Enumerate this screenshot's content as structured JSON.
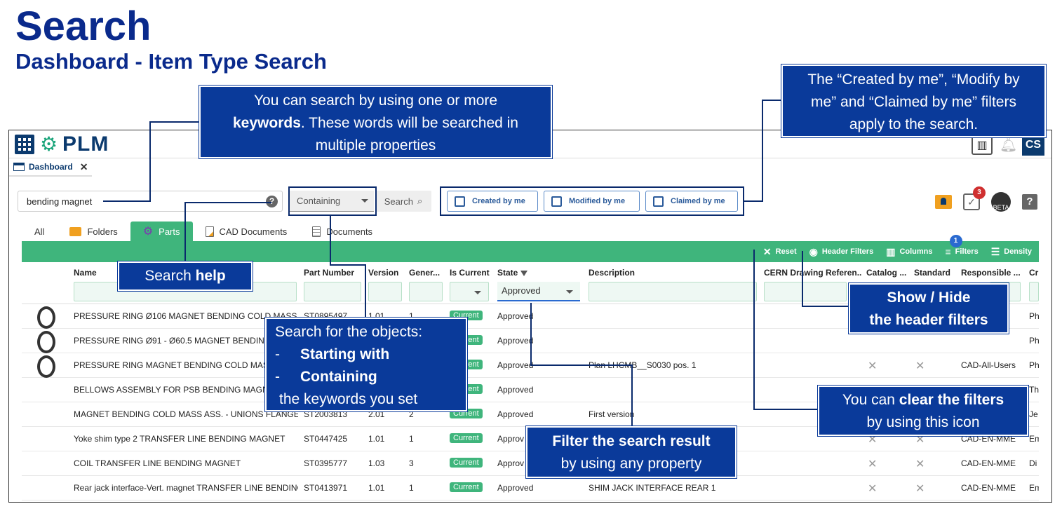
{
  "title": "Search",
  "subtitle": "Dashboard - Item Type Search",
  "app": {
    "logo": "PLM",
    "avatar": "CS",
    "tab_label": "Dashboard"
  },
  "search": {
    "value": "bending magnet",
    "mode": "Containing",
    "button": "Search"
  },
  "filters": {
    "created": "Created by me",
    "modified": "Modified by me",
    "claimed": "Claimed by me"
  },
  "badges": {
    "tasks": "3",
    "filters": "1",
    "robot": "BETA"
  },
  "object_tabs": [
    "All",
    "Folders",
    "Parts",
    "CAD Documents",
    "Documents"
  ],
  "toolbar": {
    "reset": "Reset",
    "header_filters": "Header Filters",
    "columns": "Columns",
    "filters": "Filters",
    "density": "Density"
  },
  "columns": {
    "name": "Name",
    "part_number": "Part Number",
    "version": "Version",
    "generation": "Gener...",
    "is_current": "Is Current",
    "state": "State",
    "description": "Description",
    "cern_drawing": "CERN Drawing Referen...",
    "catalog": "Catalog ...",
    "standard": "Standard",
    "responsible": "Responsible ...",
    "cr": "Cr"
  },
  "state_filter": "Approved",
  "rows": [
    {
      "name": "PRESSURE RING Ø106 MAGNET BENDING COLD MASS ASS",
      "part_number": "ST0895497",
      "version": "1.01",
      "generation": "1",
      "is_current": "Current",
      "state": "Approved",
      "description": "",
      "responsible": "...s",
      "cr": "Ph"
    },
    {
      "name": "PRESSURE RING Ø91 - Ø60.5 MAGNET BENDING C",
      "part_number": "",
      "version": "",
      "generation": "",
      "is_current": "Current",
      "state": "Approved",
      "description": "",
      "responsible": "",
      "cr": "Ph"
    },
    {
      "name": "PRESSURE RING MAGNET BENDING COLD MASS A",
      "part_number": "",
      "version": "",
      "generation": "",
      "is_current": "Current",
      "state": "Approved",
      "description": "Plan LHCMB__S0030 pos. 1",
      "responsible": "CAD-All-Users",
      "cr": "Ph"
    },
    {
      "name": "BELLOWS ASSEMBLY FOR PSB BENDING MAGNET",
      "part_number": "",
      "version": "",
      "generation": "",
      "is_current": "Current",
      "state": "Approved",
      "description": "",
      "responsible": "",
      "cr": "Th"
    },
    {
      "name": "MAGNET BENDING COLD MASS ASS. - UNIONS FLANGE",
      "part_number": "ST2003813",
      "version": "2.01",
      "generation": "2",
      "is_current": "Current",
      "state": "Approved",
      "description": "First version",
      "responsible": "",
      "cr": "Je"
    },
    {
      "name": "Yoke shim type 2 TRANSFER LINE BENDING MAGNET",
      "part_number": "ST0447425",
      "version": "1.01",
      "generation": "1",
      "is_current": "Current",
      "state": "Approv",
      "description": "",
      "responsible": "CAD-EN-MME",
      "cr": "Em"
    },
    {
      "name": "COIL TRANSFER LINE BENDING MAGNET",
      "part_number": "ST0395777",
      "version": "1.03",
      "generation": "3",
      "is_current": "Current",
      "state": "Approv",
      "description": "",
      "responsible": "CAD-EN-MME",
      "cr": "Di"
    },
    {
      "name": "Rear jack interface-Vert. magnet TRANSFER LINE BENDING I",
      "part_number": "ST0413971",
      "version": "1.01",
      "generation": "1",
      "is_current": "Current",
      "state": "Approved",
      "description": "SHIM JACK INTERFACE REAR 1",
      "responsible": "CAD-EN-MME",
      "cr": "Em"
    }
  ],
  "callouts": {
    "keywords_1": "You can search by using one or more",
    "keywords_bold": "keywords",
    "keywords_2": ". These words will be searched in",
    "keywords_3": "multiple properties",
    "created_1": "The “Created by me”, “Modify by",
    "created_2": "me” and “Claimed by me” filters",
    "created_3": "apply to the search.",
    "help_1": "Search ",
    "help_bold": "help",
    "mode_1": "Search for the objects:",
    "mode_dash": "-",
    "mode_2": "Starting with",
    "mode_3": "Containing",
    "mode_4": "the keywords you set",
    "show_hide_1": "Show / Hide",
    "show_hide_2": "the header filters",
    "clear_1": "You can ",
    "clear_bold": "clear the filters",
    "clear_2": "by using this icon",
    "filter_1": "Filter the search result",
    "filter_2": "by using any property"
  }
}
